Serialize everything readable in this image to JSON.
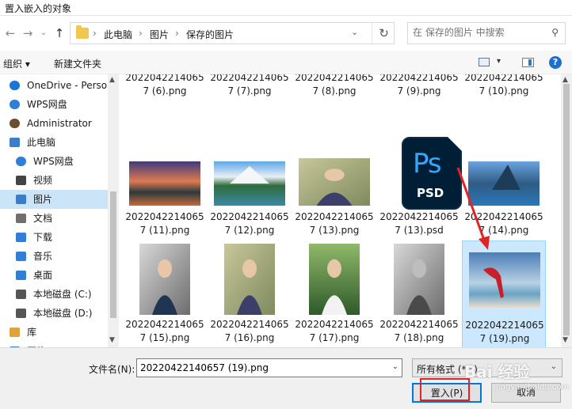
{
  "window": {
    "title": "置入嵌入的对象"
  },
  "nav": {
    "breadcrumbs": [
      "此电脑",
      "图片",
      "保存的图片"
    ],
    "search_placeholder": "在 保存的图片 中搜索"
  },
  "toolbar": {
    "organize": "组织 ▾",
    "new_folder": "新建文件夹",
    "help": "?"
  },
  "sidebar": {
    "items": [
      {
        "label": "OneDrive - Perso",
        "icon": "cloud-icon",
        "color": "#1b74d6"
      },
      {
        "label": "WPS网盘",
        "icon": "cloud-icon",
        "color": "#2f7fd6"
      },
      {
        "label": "Administrator",
        "icon": "user-icon",
        "color": "#6a4d33"
      },
      {
        "label": "此电脑",
        "icon": "computer-icon",
        "color": "#3a7ec9"
      },
      {
        "label": "WPS网盘",
        "icon": "cloud-icon",
        "color": "#2f7fd6"
      },
      {
        "label": "视频",
        "icon": "video-icon",
        "color": "#444444"
      },
      {
        "label": "图片",
        "icon": "picture-icon",
        "color": "#3a7ec9"
      },
      {
        "label": "文档",
        "icon": "document-icon",
        "color": "#6f6f6f"
      },
      {
        "label": "下载",
        "icon": "download-icon",
        "color": "#2f7fd6"
      },
      {
        "label": "音乐",
        "icon": "music-icon",
        "color": "#2f7fd6"
      },
      {
        "label": "桌面",
        "icon": "desktop-icon",
        "color": "#2f7fd6"
      },
      {
        "label": "本地磁盘 (C:)",
        "icon": "drive-icon",
        "color": "#555555"
      },
      {
        "label": "本地磁盘 (D:)",
        "icon": "drive-icon",
        "color": "#555555"
      },
      {
        "label": "库",
        "icon": "library-icon",
        "color": "#e0a23a"
      },
      {
        "label": "网络",
        "icon": "network-icon",
        "color": "#3a7ec9"
      }
    ]
  },
  "files": [
    {
      "l1": "2022042214065",
      "l2": "7 (6).png"
    },
    {
      "l1": "2022042214065",
      "l2": "7 (7).png"
    },
    {
      "l1": "2022042214065",
      "l2": "7 (8).png"
    },
    {
      "l1": "2022042214065",
      "l2": "7 (9).png"
    },
    {
      "l1": "2022042214065",
      "l2": "7 (10).png"
    },
    {
      "l1": "2022042214065",
      "l2": "7 (11).png"
    },
    {
      "l1": "2022042214065",
      "l2": "7 (12).png"
    },
    {
      "l1": "2022042214065",
      "l2": "7 (13).png"
    },
    {
      "l1": "2022042214065",
      "l2": "7 (13).psd"
    },
    {
      "l1": "2022042214065",
      "l2": "7 (14).png"
    },
    {
      "l1": "2022042214065",
      "l2": "7 (15).png"
    },
    {
      "l1": "2022042214065",
      "l2": "7 (16).png"
    },
    {
      "l1": "2022042214065",
      "l2": "7 (17).png"
    },
    {
      "l1": "2022042214065",
      "l2": "7 (18).png"
    },
    {
      "l1": "2022042214065",
      "l2": "7 (19).png"
    }
  ],
  "psd_icon": {
    "top": "Ps",
    "bottom": "PSD"
  },
  "bottom": {
    "filename_label": "文件名(N):",
    "filename_value": "20220422140657 (19).png",
    "filetype_value": "所有格式 (*.*)",
    "place_button": "置入(P)",
    "cancel_button": "取消"
  },
  "watermark": {
    "text": "Bai 经验",
    "sub": "jingyan.baidu.com"
  },
  "colors": {
    "selection": "#cce8ff",
    "accent": "#0078d7",
    "annotation_red": "#e02424"
  }
}
